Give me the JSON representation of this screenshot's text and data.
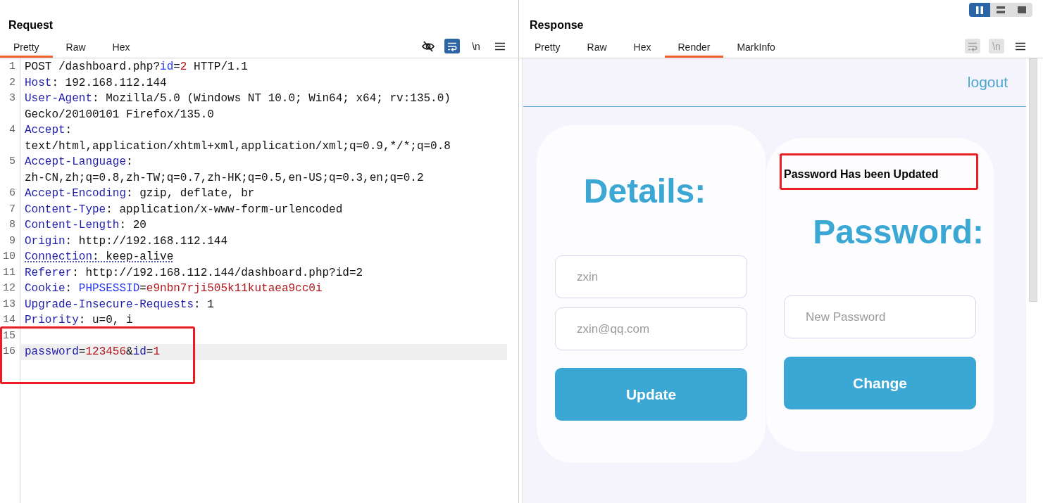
{
  "request": {
    "title": "Request",
    "tabs": [
      {
        "label": "Pretty",
        "selected": true
      },
      {
        "label": "Raw",
        "selected": false
      },
      {
        "label": "Hex",
        "selected": false
      }
    ],
    "tools": [
      {
        "kind": "visibility",
        "selected": false
      },
      {
        "kind": "wrap",
        "selected": true
      },
      {
        "kind": "newline",
        "label": "\\n",
        "selected": false
      },
      {
        "kind": "menu",
        "selected": false
      }
    ],
    "lines": [
      {
        "number": "1",
        "current": false,
        "flagged": false,
        "rows": [
          [
            {
              "kind": "plain",
              "text": "POST /dashboard.php?"
            },
            {
              "kind": "param",
              "text": "id"
            },
            {
              "kind": "plain",
              "text": "="
            },
            {
              "kind": "value",
              "text": "2"
            },
            {
              "kind": "plain",
              "text": " HTTP/1.1"
            }
          ]
        ]
      },
      {
        "number": "2",
        "current": false,
        "flagged": false,
        "rows": [
          [
            {
              "kind": "name",
              "text": "Host"
            },
            {
              "kind": "plain",
              "text": ": 192.168.112.144"
            }
          ]
        ]
      },
      {
        "number": "3",
        "current": false,
        "flagged": false,
        "rows": [
          [
            {
              "kind": "name",
              "text": "User-Agent"
            },
            {
              "kind": "plain",
              "text": ": Mozilla/5.0 (Windows NT 10.0; Win64; x64; rv:135.0)"
            }
          ],
          [
            {
              "kind": "plain",
              "text": "Gecko/20100101 Firefox/135.0"
            }
          ]
        ]
      },
      {
        "number": "4",
        "current": false,
        "flagged": false,
        "rows": [
          [
            {
              "kind": "name",
              "text": "Accept"
            },
            {
              "kind": "plain",
              "text": ":"
            }
          ],
          [
            {
              "kind": "plain",
              "text": "text/html,application/xhtml+xml,application/xml;q=0.9,*/*;q=0.8"
            }
          ]
        ]
      },
      {
        "number": "5",
        "current": false,
        "flagged": false,
        "rows": [
          [
            {
              "kind": "name",
              "text": "Accept-Language"
            },
            {
              "kind": "plain",
              "text": ":"
            }
          ],
          [
            {
              "kind": "plain",
              "text": "zh-CN,zh;q=0.8,zh-TW;q=0.7,zh-HK;q=0.5,en-US;q=0.3,en;q=0.2"
            }
          ]
        ]
      },
      {
        "number": "6",
        "current": false,
        "flagged": false,
        "rows": [
          [
            {
              "kind": "name",
              "text": "Accept-Encoding"
            },
            {
              "kind": "plain",
              "text": ": gzip, deflate, br"
            }
          ]
        ]
      },
      {
        "number": "7",
        "current": false,
        "flagged": false,
        "rows": [
          [
            {
              "kind": "name",
              "text": "Content-Type"
            },
            {
              "kind": "plain",
              "text": ": application/x-www-form-urlencoded"
            }
          ]
        ]
      },
      {
        "number": "8",
        "current": false,
        "flagged": false,
        "rows": [
          [
            {
              "kind": "name",
              "text": "Content-Length"
            },
            {
              "kind": "plain",
              "text": ": 20"
            }
          ]
        ]
      },
      {
        "number": "9",
        "current": false,
        "flagged": false,
        "rows": [
          [
            {
              "kind": "name",
              "text": "Origin"
            },
            {
              "kind": "plain",
              "text": ": http://192.168.112.144"
            }
          ]
        ]
      },
      {
        "number": "10",
        "current": false,
        "flagged": true,
        "rows": [
          [
            {
              "kind": "name",
              "text": "Connection"
            },
            {
              "kind": "plain",
              "text": ": keep-alive"
            }
          ]
        ]
      },
      {
        "number": "11",
        "current": false,
        "flagged": false,
        "rows": [
          [
            {
              "kind": "name",
              "text": "Referer"
            },
            {
              "kind": "plain",
              "text": ": http://192.168.112.144/dashboard.php?id=2"
            }
          ]
        ]
      },
      {
        "number": "12",
        "current": false,
        "flagged": false,
        "rows": [
          [
            {
              "kind": "name",
              "text": "Cookie"
            },
            {
              "kind": "plain",
              "text": ": "
            },
            {
              "kind": "param",
              "text": "PHPSESSID"
            },
            {
              "kind": "plain",
              "text": "="
            },
            {
              "kind": "value",
              "text": "e9nbn7rji505k11kutaea9cc0i"
            }
          ]
        ]
      },
      {
        "number": "13",
        "current": false,
        "flagged": false,
        "rows": [
          [
            {
              "kind": "name",
              "text": "Upgrade-Insecure-Requests"
            },
            {
              "kind": "plain",
              "text": ": 1"
            }
          ]
        ]
      },
      {
        "number": "14",
        "current": false,
        "flagged": false,
        "rows": [
          [
            {
              "kind": "name",
              "text": "Priority"
            },
            {
              "kind": "plain",
              "text": ": u=0, i"
            }
          ]
        ]
      },
      {
        "number": "15",
        "current": false
      },
      {
        "number": "16",
        "current": true,
        "flagged": false,
        "rows": [
          [
            {
              "kind": "name",
              "text": "password"
            },
            {
              "kind": "plain",
              "text": "="
            },
            {
              "kind": "value",
              "text": "123456"
            },
            {
              "kind": "plain",
              "text": "&"
            },
            {
              "kind": "name",
              "text": "id"
            },
            {
              "kind": "plain",
              "text": "="
            },
            {
              "kind": "value",
              "text": "1"
            }
          ]
        ]
      }
    ],
    "annotation_box": true
  },
  "layout_toggle": [
    {
      "kind": "columns",
      "selected": true
    },
    {
      "kind": "rows",
      "selected": false
    },
    {
      "kind": "single",
      "selected": false
    }
  ],
  "response": {
    "title": "Response",
    "tabs": [
      {
        "label": "Pretty",
        "selected": false
      },
      {
        "label": "Raw",
        "selected": false
      },
      {
        "label": "Hex",
        "selected": false
      },
      {
        "label": "Render",
        "selected": true
      },
      {
        "label": "MarkInfo",
        "selected": false
      }
    ],
    "tools": [
      {
        "kind": "wrap",
        "disabled": true
      },
      {
        "kind": "newline",
        "label": "\\n",
        "disabled": true
      },
      {
        "kind": "menu",
        "disabled": false
      }
    ],
    "render": {
      "logout": "logout",
      "cards": [
        {
          "kind": "details",
          "heading": "Details:",
          "fields": [
            {
              "placeholder": "zxin"
            },
            {
              "placeholder": "zxin@qq.com"
            }
          ],
          "button": "Update"
        },
        {
          "kind": "password",
          "message": {
            "text": "Password Has been Updated",
            "boxed": true
          },
          "heading": "Password:",
          "fields": [
            {
              "placeholder": "New Password"
            }
          ],
          "button": "Change"
        }
      ]
    }
  }
}
